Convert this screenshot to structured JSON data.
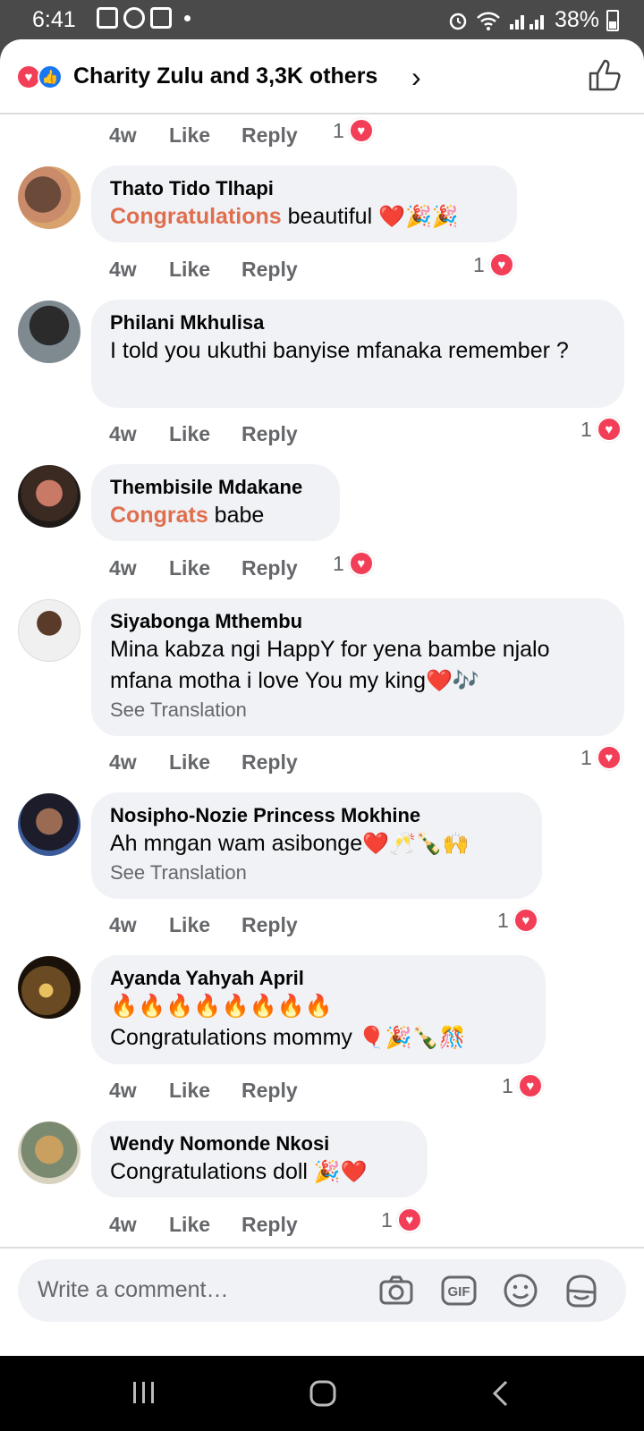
{
  "status": {
    "time": "6:41",
    "battery": "38%"
  },
  "reactions": {
    "summary": "Charity Zulu and 3,3K others"
  },
  "first_actions": {
    "time": "4w",
    "like": "Like",
    "reply": "Reply",
    "count": "1"
  },
  "comments": [
    {
      "name": "Thato Tido Tlhapi",
      "highlight": "Congratulations",
      "text": " beautiful ",
      "emoji": "❤️🎉🎉",
      "translation": "",
      "time": "4w",
      "like": "Like",
      "reply": "Reply",
      "count": "1"
    },
    {
      "name": "Philani Mkhulisa",
      "highlight": "",
      "text": "I told you ukuthi banyise mfanaka remember ?",
      "emoji": "",
      "translation": "",
      "time": "4w",
      "like": "Like",
      "reply": "Reply",
      "count": "1"
    },
    {
      "name": "Thembisile Mdakane",
      "highlight": "Congrats",
      "text": " babe",
      "emoji": "",
      "translation": "",
      "time": "4w",
      "like": "Like",
      "reply": "Reply",
      "count": "1"
    },
    {
      "name": "Siyabonga Mthembu",
      "highlight": "",
      "text": "Mina kabza ngi HappY for yena  bambe njalo mfana motha i love You my king",
      "emoji": "❤️🎶",
      "translation": "See Translation",
      "time": "4w",
      "like": "Like",
      "reply": "Reply",
      "count": "1"
    },
    {
      "name": "Nosipho-Nozie Princess Mokhine",
      "highlight": "",
      "text": "Ah mngan wam asibonge",
      "emoji": "❤️🥂🍾🙌",
      "translation": "See Translation",
      "time": "4w",
      "like": "Like",
      "reply": "Reply",
      "count": "1"
    },
    {
      "name": "Ayanda Yahyah April",
      "highlight": "",
      "text": "Congratulations mommy ",
      "emoji_line": "🔥🔥🔥🔥🔥🔥🔥🔥",
      "emoji": "🎈🎉🍾🎊",
      "translation": "",
      "time": "4w",
      "like": "Like",
      "reply": "Reply",
      "count": "1"
    },
    {
      "name": "Wendy Nomonde Nkosi",
      "highlight": "",
      "text": "Congratulations doll ",
      "emoji": "🎉❤️",
      "translation": "",
      "time": "4w",
      "like": "Like",
      "reply": "Reply",
      "count": "1"
    }
  ],
  "composer": {
    "placeholder": "Write a comment…"
  },
  "icons": [
    "love-reaction-icon",
    "like-reaction-icon",
    "chevron-right-icon",
    "thumbs-up-icon",
    "camera-icon",
    "gif-icon",
    "emoji-icon",
    "sticker-icon",
    "recents-icon",
    "home-icon",
    "back-icon"
  ],
  "colors": {
    "accent": "#e06e4e",
    "love": "#f33e58",
    "like": "#1877f2",
    "bubble": "#f0f2f5"
  }
}
